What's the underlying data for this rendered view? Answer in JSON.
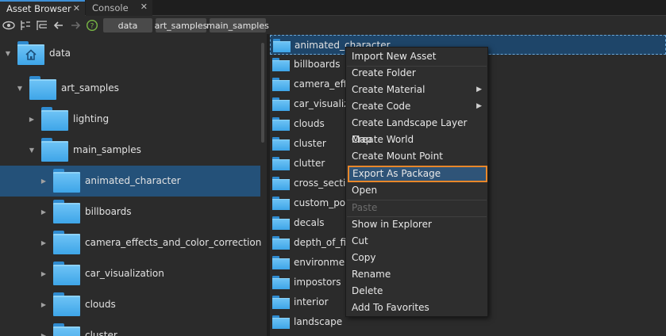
{
  "tabs": [
    {
      "label": "Asset Browser",
      "active": true
    },
    {
      "label": "Console",
      "active": false
    }
  ],
  "toolbar": {
    "icons": [
      "eye-icon",
      "tree-collapse-icon",
      "tree-expand-icon",
      "arrow-left-icon",
      "arrow-right-icon",
      "help-icon"
    ],
    "breadcrumbs": [
      "data",
      "art_samples",
      "main_samples"
    ]
  },
  "tree": {
    "items": [
      {
        "label": "data",
        "expanded": true
      },
      {
        "label": "art_samples",
        "expanded": true
      },
      {
        "label": "lighting",
        "expanded": false
      },
      {
        "label": "main_samples",
        "expanded": true
      },
      {
        "label": "animated_character",
        "expanded": false,
        "selected": true
      },
      {
        "label": "billboards",
        "expanded": false
      },
      {
        "label": "camera_effects_and_color_correction",
        "expanded": false
      },
      {
        "label": "car_visualization",
        "expanded": false
      },
      {
        "label": "clouds",
        "expanded": false
      },
      {
        "label": "cluster",
        "expanded": false
      }
    ]
  },
  "list": {
    "items": [
      "animated_character",
      "billboards",
      "camera_effec",
      "car_visualizat",
      "clouds",
      "cluster",
      "clutter",
      "cross_section",
      "custom_post",
      "decals",
      "depth_of_fie",
      "environment",
      "impostors",
      "interior",
      "landscape"
    ]
  },
  "context_menu": {
    "items": [
      {
        "label": "Import New Asset",
        "enabled": true
      },
      {
        "label": "Create Folder",
        "enabled": true
      },
      {
        "label": "Create Material",
        "enabled": true,
        "submenu": true
      },
      {
        "label": "Create Code",
        "enabled": true,
        "submenu": true
      },
      {
        "label": "Create Landscape Layer Map",
        "enabled": true
      },
      {
        "label": "Create World",
        "enabled": true
      },
      {
        "label": "Create Mount Point",
        "enabled": true
      },
      {
        "label": "Export As Package",
        "enabled": true,
        "highlighted": true
      },
      {
        "label": "Open",
        "enabled": true
      },
      {
        "label": "Paste",
        "enabled": false
      },
      {
        "label": "Show in Explorer",
        "enabled": true
      },
      {
        "label": "Cut",
        "enabled": true
      },
      {
        "label": "Copy",
        "enabled": true
      },
      {
        "label": "Rename",
        "enabled": true
      },
      {
        "label": "Delete",
        "enabled": true
      },
      {
        "label": "Add To Favorites",
        "enabled": true
      }
    ]
  },
  "colors": {
    "accent": "#3d8fd6",
    "highlight_border": "#e8872a",
    "selection": "#245179",
    "folder": "#4fb3ee"
  }
}
